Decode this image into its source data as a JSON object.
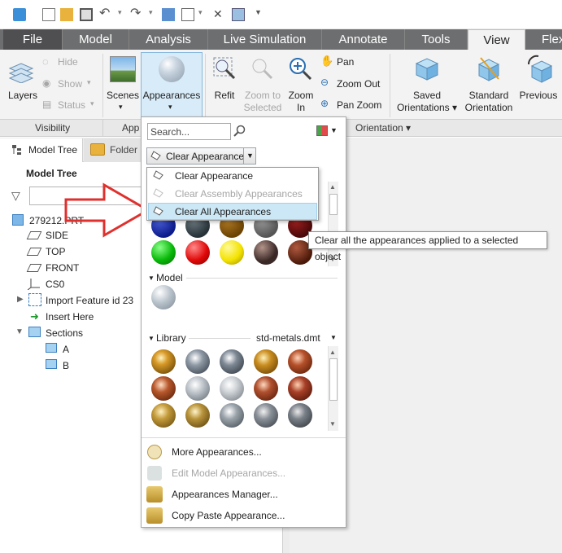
{
  "tabs": [
    "File",
    "Model",
    "Analysis",
    "Live Simulation",
    "Annotate",
    "Tools",
    "View",
    "Flex"
  ],
  "ribbon": {
    "layers": "Layers",
    "hide": "Hide",
    "show": "Show",
    "status": "Status",
    "scenes": "Scenes",
    "appearances": "Appearances",
    "refit": "Refit",
    "zoom_to_selected_1": "Zoom to",
    "zoom_to_selected_2": "Selected",
    "zoom_in_1": "Zoom",
    "zoom_in_2": "In",
    "pan": "Pan",
    "zoom_out": "Zoom Out",
    "pan_zoom": "Pan Zoom",
    "saved_orient_1": "Saved",
    "saved_orient_2": "Orientations",
    "standard_orient_1": "Standard",
    "standard_orient_2": "Orientation",
    "previous": "Previous",
    "groups": {
      "visibility": "Visibility",
      "app": "App",
      "orientation": "Orientation"
    }
  },
  "left_panel": {
    "tab_model_tree": "Model Tree",
    "tab_folder_browser": "Folder B",
    "header": "Model Tree",
    "items": [
      "279212.PRT",
      "SIDE",
      "TOP",
      "FRONT",
      "CS0",
      "Import Feature id 23",
      "Insert Here",
      "Sections",
      "A",
      "B"
    ]
  },
  "dropdown": {
    "search_placeholder": "Search...",
    "clear_button": "Clear Appearance",
    "clear_menu": [
      "Clear Appearance",
      "Clear Assembly Appearances",
      "Clear All Appearances"
    ],
    "model_section": "Model",
    "library_section": "Library",
    "library_file": "std-metals.dmt",
    "footer": [
      "More Appearances...",
      "Edit Model Appearances...",
      "Appearances Manager...",
      "Copy Paste Appearance..."
    ]
  },
  "tooltip": "Clear all the appearances applied to a selected object",
  "colors": {
    "tab_bar": "#6d6e70",
    "file_tab": "#4f4f51",
    "highlight": "#cce8f6",
    "arrow": "#e0302e"
  }
}
